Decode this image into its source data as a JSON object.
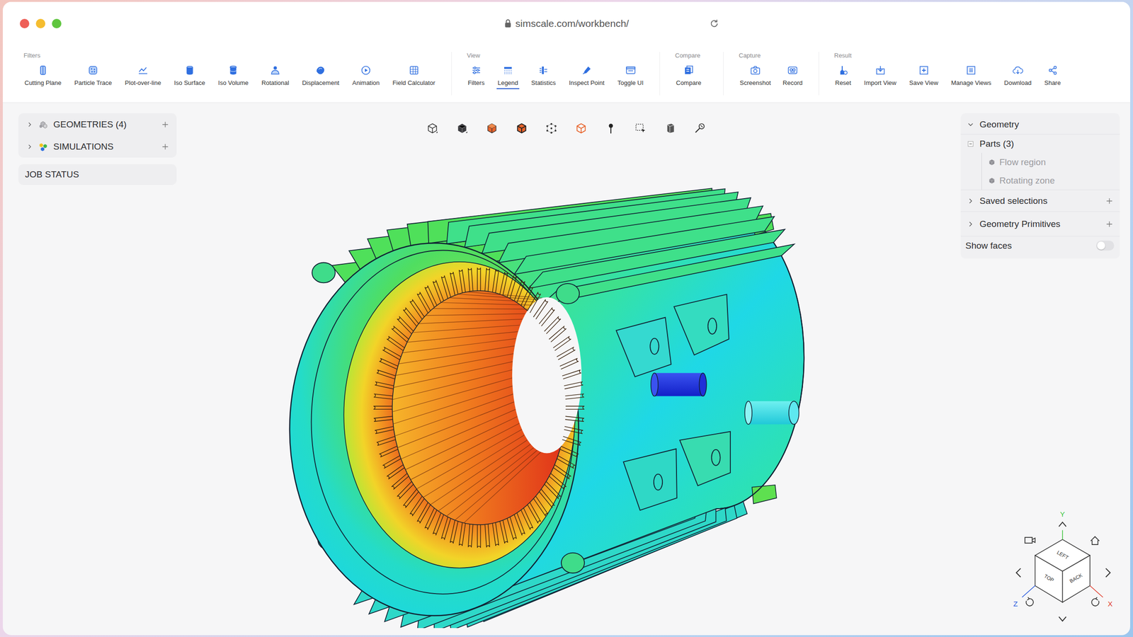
{
  "window": {
    "url": "simscale.com/workbench/"
  },
  "toolbar": [
    {
      "group": "Filters",
      "items": [
        {
          "label": "Cutting Plane",
          "selected": false
        },
        {
          "label": "Particle Trace",
          "selected": false
        },
        {
          "label": "Plot-over-line",
          "selected": false
        },
        {
          "label": "Iso Surface",
          "selected": false
        },
        {
          "label": "Iso Volume",
          "selected": false
        },
        {
          "label": "Rotational",
          "selected": false
        },
        {
          "label": "Displacement",
          "selected": false
        },
        {
          "label": "Animation",
          "selected": false
        },
        {
          "label": "Field Calculator",
          "selected": false
        }
      ]
    },
    {
      "group": "View",
      "items": [
        {
          "label": "Filters",
          "selected": false
        },
        {
          "label": "Legend",
          "selected": true
        },
        {
          "label": "Statistics",
          "selected": false
        },
        {
          "label": "Inspect Point",
          "selected": false
        },
        {
          "label": "Toggle UI",
          "selected": false
        }
      ]
    },
    {
      "group": "Compare",
      "items": [
        {
          "label": "Compare",
          "selected": false
        }
      ]
    },
    {
      "group": "Capture",
      "items": [
        {
          "label": "Screenshot",
          "selected": false
        },
        {
          "label": "Record",
          "selected": false
        }
      ]
    },
    {
      "group": "Result",
      "items": [
        {
          "label": "Reset",
          "selected": false
        },
        {
          "label": "Import View",
          "selected": false
        },
        {
          "label": "Save View",
          "selected": false
        },
        {
          "label": "Manage Views",
          "selected": false
        },
        {
          "label": "Download",
          "selected": false
        },
        {
          "label": "Share",
          "selected": false
        }
      ]
    }
  ],
  "sidebar": {
    "sections": [
      {
        "label": "GEOMETRIES (4)",
        "expanded": false
      },
      {
        "label": "SIMULATIONS",
        "expanded": false
      }
    ],
    "job_status": "JOB STATUS"
  },
  "scene_panel": {
    "title": "Geometry",
    "expanded": true,
    "parts": {
      "label": "Parts (3)",
      "expanded": true,
      "items": [
        {
          "label": "Flow region",
          "greyed": true
        },
        {
          "label": "Rotating zone",
          "greyed": true
        }
      ]
    },
    "sections": [
      {
        "label": "Saved selections",
        "expanded": false
      },
      {
        "label": "Geometry Primitives",
        "expanded": false
      }
    ],
    "show_faces": {
      "label": "Show faces",
      "on": false
    }
  },
  "view_cube": {
    "faces": {
      "top": "LEFT",
      "left": "TOP",
      "right": "BACK"
    },
    "axes": {
      "y": "Y",
      "z": "Z",
      "x": "X"
    }
  }
}
